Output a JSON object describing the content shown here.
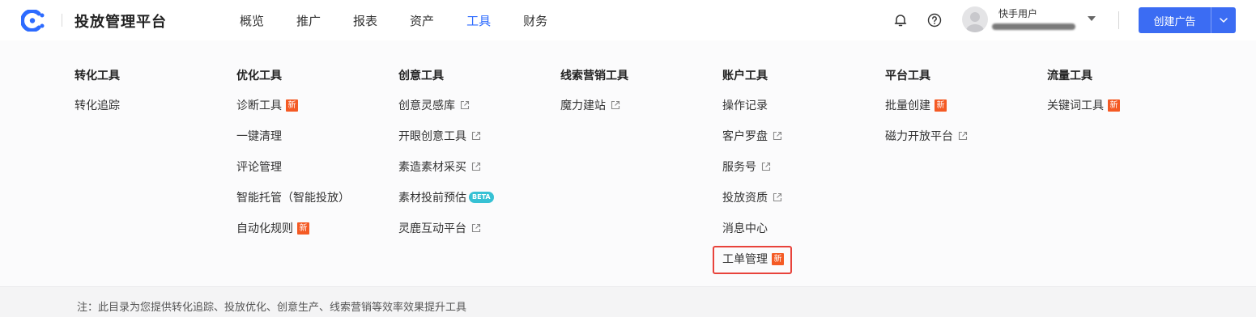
{
  "app": {
    "title": "投放管理平台",
    "brand_color": "#2d6bff"
  },
  "nav": {
    "items": [
      {
        "label": "概览",
        "active": false
      },
      {
        "label": "推广",
        "active": false
      },
      {
        "label": "报表",
        "active": false
      },
      {
        "label": "资产",
        "active": false
      },
      {
        "label": "工具",
        "active": true
      },
      {
        "label": "财务",
        "active": false
      }
    ]
  },
  "header": {
    "user_name": "快手用户",
    "create_button": "创建广告"
  },
  "menu": {
    "columns": [
      {
        "title": "转化工具",
        "items": [
          {
            "label": "转化追踪"
          }
        ]
      },
      {
        "title": "优化工具",
        "items": [
          {
            "label": "诊断工具",
            "badge": "新"
          },
          {
            "label": "一键清理"
          },
          {
            "label": "评论管理"
          },
          {
            "label": "智能托管（智能投放）"
          },
          {
            "label": "自动化规则",
            "badge": "新"
          }
        ]
      },
      {
        "title": "创意工具",
        "items": [
          {
            "label": "创意灵感库",
            "external": true
          },
          {
            "label": "开眼创意工具",
            "external": true
          },
          {
            "label": "素造素材采买",
            "external": true
          },
          {
            "label": "素材投前预估",
            "badge_beta": "BETA"
          },
          {
            "label": "灵鹿互动平台",
            "external": true
          }
        ]
      },
      {
        "title": "线索营销工具",
        "items": [
          {
            "label": "魔力建站",
            "external": true
          }
        ]
      },
      {
        "title": "账户工具",
        "items": [
          {
            "label": "操作记录"
          },
          {
            "label": "客户罗盘",
            "external": true
          },
          {
            "label": "服务号",
            "external": true
          },
          {
            "label": "投放资质",
            "external": true
          },
          {
            "label": "消息中心"
          },
          {
            "label": "工单管理",
            "badge": "新",
            "highlighted": true
          }
        ]
      },
      {
        "title": "平台工具",
        "items": [
          {
            "label": "批量创建",
            "badge": "新"
          },
          {
            "label": "磁力开放平台",
            "external": true
          }
        ]
      },
      {
        "title": "流量工具",
        "items": [
          {
            "label": "关键词工具",
            "badge": "新"
          }
        ]
      }
    ]
  },
  "footer": {
    "note": "注：此目录为您提供转化追踪、投放优化、创意生产、线索营销等效率效果提升工具"
  },
  "colors": {
    "badge_new": "#f45a24",
    "badge_beta": "#36c1d4",
    "highlight": "#e8433b",
    "primary_button": "#3b6cf3"
  }
}
